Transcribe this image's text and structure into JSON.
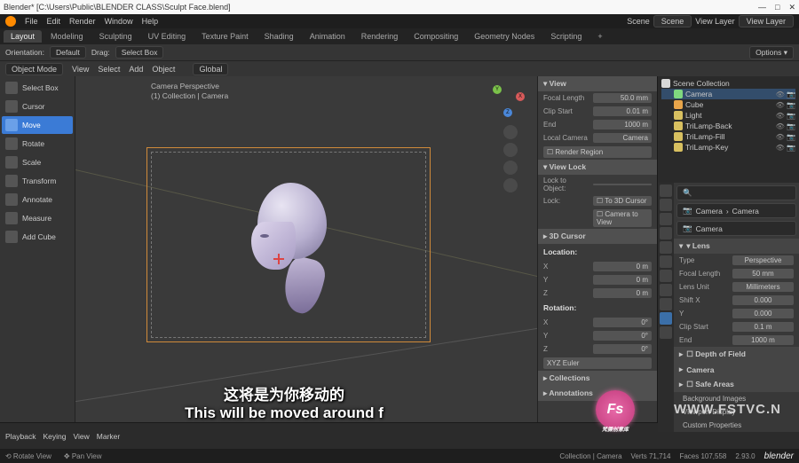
{
  "titlebar": {
    "title": "Blender* [C:\\Users\\Public\\BLENDER CLASS\\Sculpt Face.blend]",
    "min": "—",
    "max": "□",
    "close": "✕"
  },
  "menubar": {
    "items": [
      "File",
      "Edit",
      "Render",
      "Window",
      "Help"
    ],
    "scene_label": "Scene",
    "scene": "Scene",
    "viewlayer_label": "View Layer",
    "viewlayer": "View Layer"
  },
  "workspaces": [
    "Layout",
    "Modeling",
    "Sculpting",
    "UV Editing",
    "Texture Paint",
    "Shading",
    "Animation",
    "Rendering",
    "Compositing",
    "Geometry Nodes",
    "Scripting",
    "+"
  ],
  "workspace_active": 0,
  "toolsettings": {
    "orient_label": "Orientation:",
    "orient": "Default",
    "drag_label": "Drag:",
    "drag": "Select Box",
    "options": "Options ▾"
  },
  "header3d": {
    "mode": "Object Mode",
    "menus": [
      "View",
      "Select",
      "Add",
      "Object"
    ],
    "global": "Global"
  },
  "toolbar": [
    {
      "name": "select-box",
      "label": "Select Box"
    },
    {
      "name": "cursor",
      "label": "Cursor"
    },
    {
      "name": "move",
      "label": "Move"
    },
    {
      "name": "rotate",
      "label": "Rotate"
    },
    {
      "name": "scale",
      "label": "Scale"
    },
    {
      "name": "transform",
      "label": "Transform"
    },
    {
      "name": "annotate",
      "label": "Annotate"
    },
    {
      "name": "measure",
      "label": "Measure"
    },
    {
      "name": "add-cube",
      "label": "Add Cube"
    }
  ],
  "toolbar_active": 2,
  "camlabel": {
    "l1": "Camera Perspective",
    "l2": "(1) Collection | Camera"
  },
  "npanel": {
    "view_title": "▾ View",
    "focal_label": "Focal Length",
    "focal": "50.0 mm",
    "clip_start_label": "Clip Start",
    "clip_start": "0.01 m",
    "end_label": "End",
    "end": "1000 m",
    "localcam_label": "Local Camera",
    "localcam": "Camera",
    "renderregion": "☐ Render Region",
    "viewlock_title": "▾ View Lock",
    "lockto_label": "Lock to Object:",
    "lock_label": "Lock:",
    "lock_cursor": "☐ To 3D Cursor",
    "lock_cam": "☐ Camera to View",
    "cursor_title": "▸ 3D Cursor",
    "loc_label": "Location:",
    "x": "X",
    "y": "Y",
    "z": "Z",
    "loc_x": "0 m",
    "loc_y": "0 m",
    "loc_z": "0 m",
    "rot_label": "Rotation:",
    "rot_x": "0°",
    "rot_y": "0°",
    "rot_z": "0°",
    "euler": "XYZ Euler",
    "coll": "▸ Collections",
    "ann": "▸ Annotations"
  },
  "outliner": {
    "title": "Scene Collection",
    "items": [
      {
        "icon": "cam",
        "label": "Camera",
        "sel": true
      },
      {
        "icon": "mesh",
        "label": "Cube"
      },
      {
        "icon": "light",
        "label": "Light"
      },
      {
        "icon": "light",
        "label": "TriLamp-Back"
      },
      {
        "icon": "light",
        "label": "TriLamp-Fill"
      },
      {
        "icon": "light",
        "label": "TriLamp-Key"
      }
    ]
  },
  "props": {
    "search": "🔍",
    "breadcrumb_cam": "Camera",
    "breadcrumb_data": "Camera",
    "data_pill": "Camera",
    "lens_title": "▾ Lens",
    "type_label": "Type",
    "type": "Perspective",
    "focal_label": "Focal Length",
    "focal": "50 mm",
    "unit_label": "Lens Unit",
    "unit": "Millimeters",
    "shiftx_label": "Shift X",
    "shiftx": "0.000",
    "shifty_label": "Y",
    "shifty": "0.000",
    "clipstart_label": "Clip Start",
    "clipstart": "0.1 m",
    "clipend_label": "End",
    "clipend": "1000 m",
    "sections": [
      "☐ Depth of Field",
      "Camera",
      "☐ Safe Areas",
      "Background Images",
      "Viewport Display",
      "Custom Properties"
    ]
  },
  "timeline": {
    "menus": [
      "Playback",
      "Keying",
      "View",
      "Marker"
    ]
  },
  "statusbar": {
    "hints": [
      "⟲ Rotate View",
      "✥ Pan View"
    ],
    "collection": "Collection | Camera",
    "verts": "Verts 71,714",
    "faces": "Faces 107,558",
    "ver": "2.93.0",
    "word": "blender"
  },
  "subtitle": {
    "cn": "这将是为你移动的",
    "en": "This will be moved around f"
  },
  "watermark": {
    "badge": "Fs",
    "url": "WWW.FSTVC.N"
  }
}
